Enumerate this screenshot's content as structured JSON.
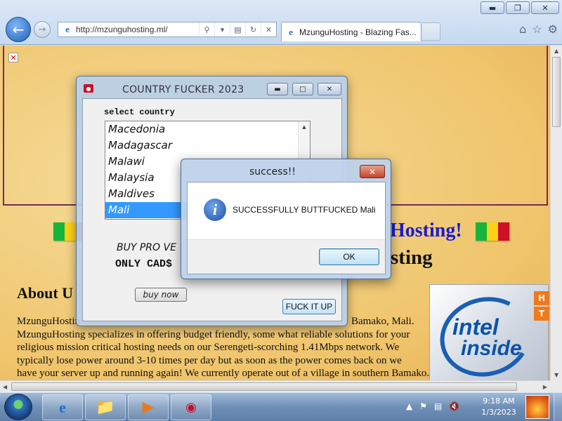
{
  "browser": {
    "url": "http://mzunguhosting.ml/",
    "tab_title": "MzunguHosting - Blazing Fas...",
    "window_minimize": "▬",
    "window_restore": "❐",
    "window_close": "✕",
    "icons": [
      "back-arrow-icon",
      "forward-arrow-icon",
      "ie-logo-icon",
      "search-icon",
      "compat-view-icon",
      "refresh-icon",
      "stop-icon",
      "home-icon",
      "favorites-star-icon",
      "tools-gear-icon"
    ]
  },
  "page": {
    "heading_right": "Hosting!",
    "subheading_right": "sting",
    "about_title": "About U",
    "about_lines": [
      "MzunguHostin",
      "Bamako, Mali.",
      "MzunguHosting specializes in offering budget friendly, some what reliable solutions for your",
      "religious mission critical hosting needs on our Serengeti-scorching 1.41Mbps network. We",
      "typically lose power around 3-10 times per day but as soon as the power comes back on we",
      "have your server up and running again! We currently operate out of a village in southern Bamako."
    ],
    "intel_word1": "intel",
    "intel_word2": "inside",
    "badge_h": "H",
    "badge_t": "T",
    "mali_flag_colors": [
      "#14b53a",
      "#fcd116",
      "#ce1126"
    ]
  },
  "app_window": {
    "title": "COUNTRY FUCKER 2023",
    "select_label": "select country",
    "countries": [
      "Macedonia",
      "Madagascar",
      "Malawi",
      "Malaysia",
      "Maldives",
      "Mali"
    ],
    "selected_country": "Mali",
    "buy_pro_text": "BUY PRO VE",
    "only_cad_text": "ONLY CAD$",
    "buy_now_label": "buy now",
    "action_label": "FUCK IT UP"
  },
  "dialog": {
    "title": "success!!",
    "message": "SUCCESSFULLY BUTTFUCKED Mali",
    "ok_label": "OK",
    "close_glyph": "✕"
  },
  "taskbar": {
    "items": [
      "internet-explorer",
      "file-explorer",
      "media-player",
      "country-fucker-app"
    ],
    "time": "9:18 AM",
    "date": "1/3/2023"
  },
  "colors": {
    "heading_blue": "#1a1ad6",
    "list_selection": "#3399ff",
    "banner_border": "#7a2a55",
    "page_background": "#efc46b"
  }
}
